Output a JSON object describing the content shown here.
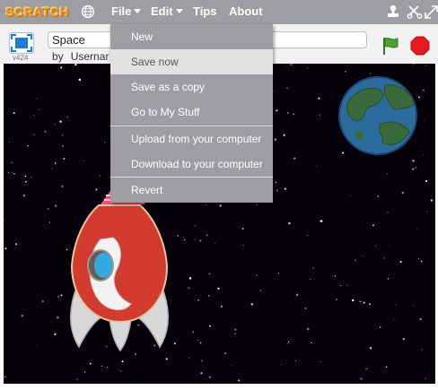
{
  "menubar": {
    "logo_text": "SCRATCH",
    "file_label": "File",
    "edit_label": "Edit",
    "tips_label": "Tips",
    "about_label": "About",
    "icons": [
      "globe-icon",
      "duplicate-stamp-icon",
      "cut-scissors-icon",
      "grow-icon"
    ]
  },
  "project": {
    "title_value": "Space",
    "by_label": "by",
    "username": "Usernar",
    "version": "v424"
  },
  "controls": {
    "green_flag": "green-flag-icon",
    "stop": "stop-sign-icon"
  },
  "file_menu": {
    "items": [
      "New",
      "Save now",
      "Save as a copy",
      "Go to My Stuff",
      "Upload from your computer",
      "Download to your computer",
      "Revert"
    ],
    "highlighted": "Save now"
  },
  "stage": {
    "sprites": [
      "rocket-sprite",
      "earth-sprite"
    ],
    "background": "starfield"
  },
  "colors": {
    "menubar": "#9c9ea2",
    "logo": "#f7a21b",
    "stage_bg": "#06000a",
    "rocket_red": "#d23b2d",
    "earth_water": "#2b6c9e",
    "earth_land": "#3a6a3a",
    "flag_green": "#4aa52e",
    "stop_red": "#e8191f"
  }
}
